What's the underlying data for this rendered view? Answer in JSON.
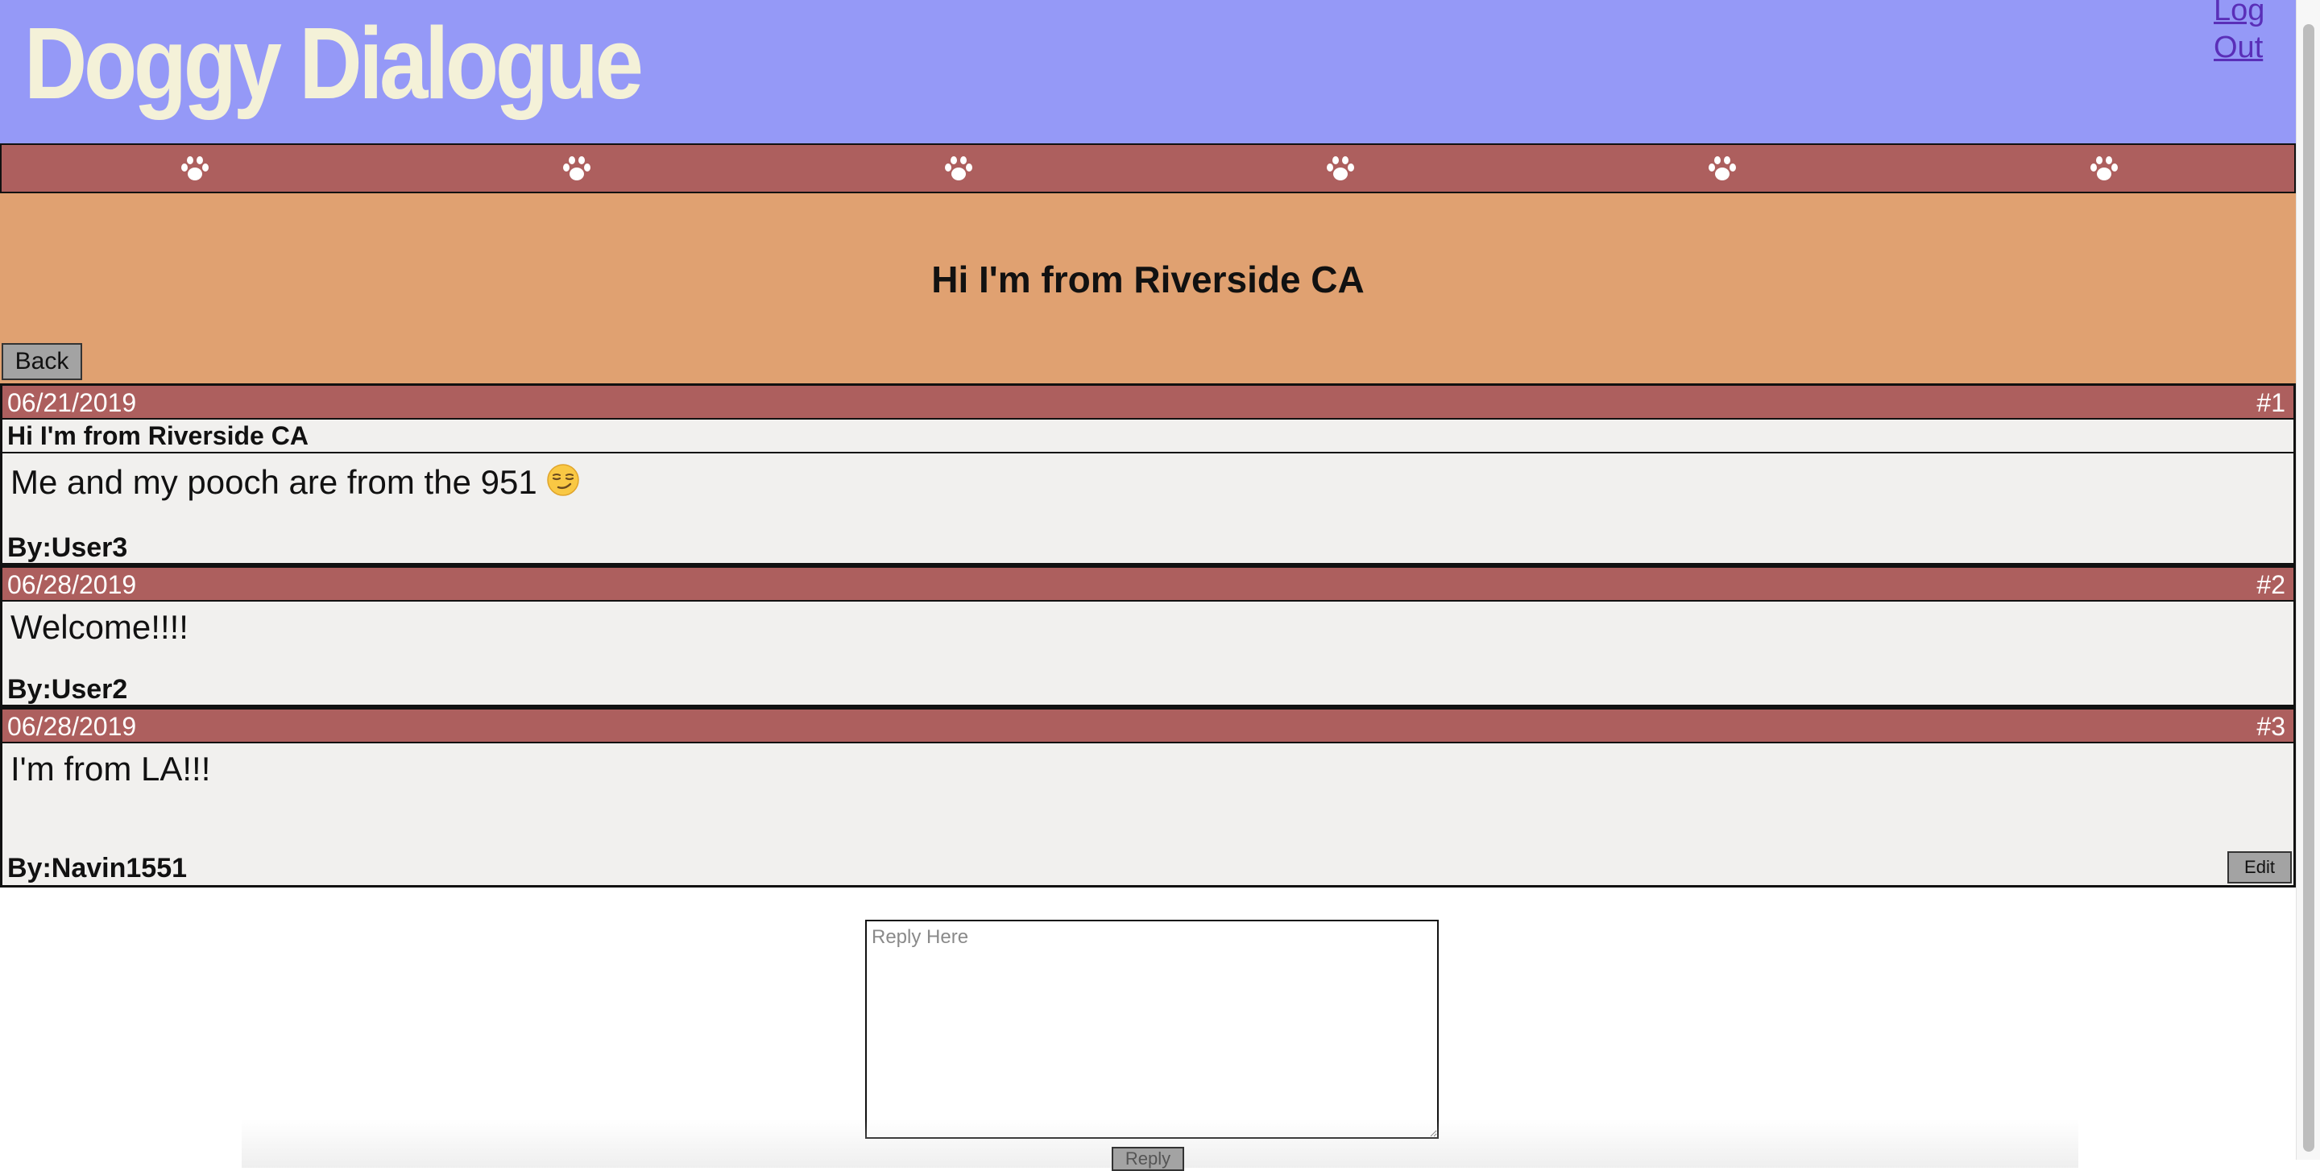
{
  "header": {
    "title": "Doggy Dialogue",
    "logout_label": "Log Out",
    "colors": {
      "background": "#9599f7",
      "title": "#f4f1d8",
      "link": "#5a2fb8"
    }
  },
  "paw_bar": {
    "icon": "paw-icon",
    "count": 6,
    "color": "#ad5f5e"
  },
  "thread": {
    "title": "Hi I'm from Riverside CA",
    "back_label": "Back",
    "background": "#e0a171"
  },
  "posts": [
    {
      "date": "06/21/2019",
      "number": "#1",
      "subject": "Hi I'm from Riverside CA",
      "body": "Me and my pooch are from the 951",
      "emoji": "smirking-face-icon",
      "author": "By:User3"
    },
    {
      "date": "06/28/2019",
      "number": "#2",
      "body": "Welcome!!!!",
      "author": "By:User2"
    },
    {
      "date": "06/28/2019",
      "number": "#3",
      "body": "I'm from LA!!!",
      "author": "By:Navin1551",
      "edit_label": "Edit"
    }
  ],
  "reply": {
    "placeholder": "Reply Here",
    "value": "",
    "button_label": "Reply"
  }
}
